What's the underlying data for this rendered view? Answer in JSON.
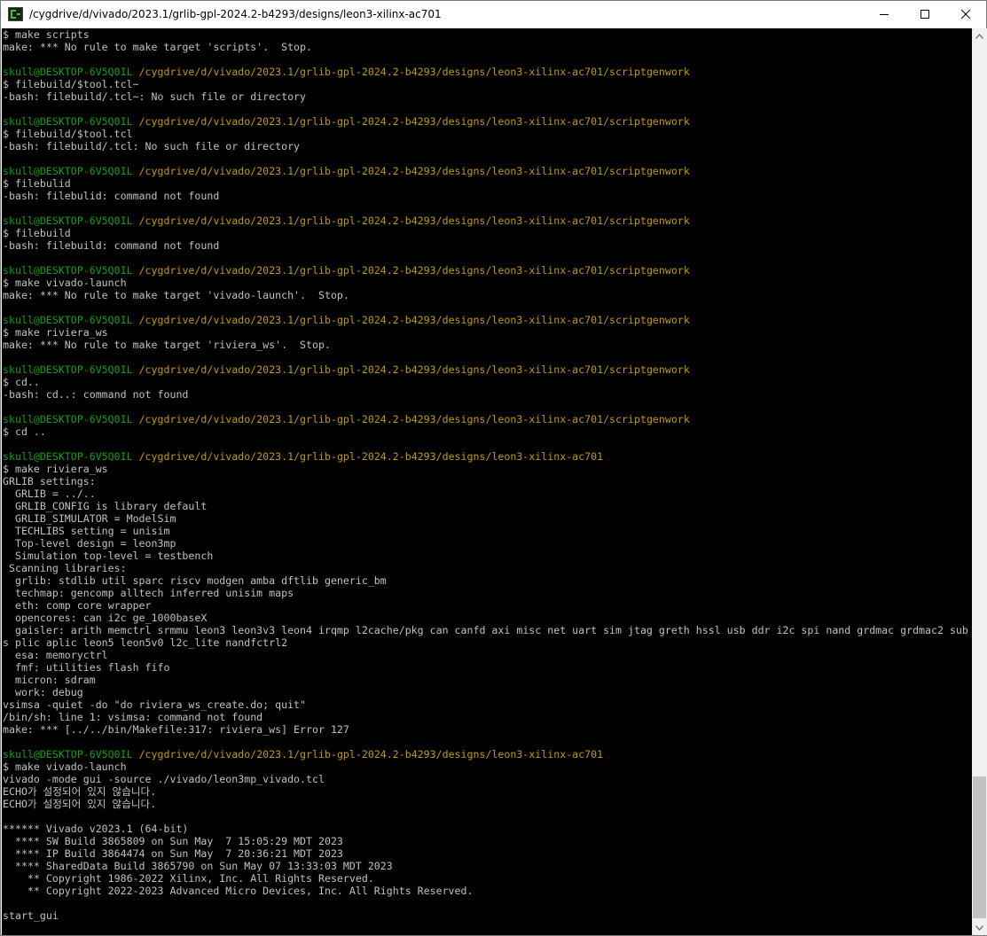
{
  "window": {
    "title": "/cygdrive/d/vivado/2023.1/grlib-gpl-2024.2-b4293/designs/leon3-xilinx-ac701",
    "buttons": {
      "minimize": "minimize",
      "maximize": "maximize",
      "close": "close"
    },
    "app_icon": "mintty-icon"
  },
  "colors": {
    "background": "#000000",
    "text": "#c0c0c0",
    "user": "#13a10e",
    "path": "#c19c00"
  },
  "terminal": {
    "prompt_user": "skull@DESKTOP-6V5Q0IL",
    "lines": [
      {
        "type": "text",
        "text": "$ make scripts"
      },
      {
        "type": "text",
        "text": "make: *** No rule to make target 'scripts'.  Stop."
      },
      {
        "type": "blank",
        "text": ""
      },
      {
        "type": "prompt",
        "user": "skull@DESKTOP-6V5Q0IL",
        "path": "/cygdrive/d/vivado/2023.1/grlib-gpl-2024.2-b4293/designs/leon3-xilinx-ac701/scriptgenwork"
      },
      {
        "type": "text",
        "text": "$ filebuild/$tool.tcl~"
      },
      {
        "type": "text",
        "text": "-bash: filebuild/.tcl~: No such file or directory"
      },
      {
        "type": "blank",
        "text": ""
      },
      {
        "type": "prompt",
        "user": "skull@DESKTOP-6V5Q0IL",
        "path": "/cygdrive/d/vivado/2023.1/grlib-gpl-2024.2-b4293/designs/leon3-xilinx-ac701/scriptgenwork"
      },
      {
        "type": "text",
        "text": "$ filebuild/$tool.tcl"
      },
      {
        "type": "text",
        "text": "-bash: filebuild/.tcl: No such file or directory"
      },
      {
        "type": "blank",
        "text": ""
      },
      {
        "type": "prompt",
        "user": "skull@DESKTOP-6V5Q0IL",
        "path": "/cygdrive/d/vivado/2023.1/grlib-gpl-2024.2-b4293/designs/leon3-xilinx-ac701/scriptgenwork"
      },
      {
        "type": "text",
        "text": "$ filebulid"
      },
      {
        "type": "text",
        "text": "-bash: filebulid: command not found"
      },
      {
        "type": "blank",
        "text": ""
      },
      {
        "type": "prompt",
        "user": "skull@DESKTOP-6V5Q0IL",
        "path": "/cygdrive/d/vivado/2023.1/grlib-gpl-2024.2-b4293/designs/leon3-xilinx-ac701/scriptgenwork"
      },
      {
        "type": "text",
        "text": "$ filebuild"
      },
      {
        "type": "text",
        "text": "-bash: filebuild: command not found"
      },
      {
        "type": "blank",
        "text": ""
      },
      {
        "type": "prompt",
        "user": "skull@DESKTOP-6V5Q0IL",
        "path": "/cygdrive/d/vivado/2023.1/grlib-gpl-2024.2-b4293/designs/leon3-xilinx-ac701/scriptgenwork"
      },
      {
        "type": "text",
        "text": "$ make vivado-launch"
      },
      {
        "type": "text",
        "text": "make: *** No rule to make target 'vivado-launch'.  Stop."
      },
      {
        "type": "blank",
        "text": ""
      },
      {
        "type": "prompt",
        "user": "skull@DESKTOP-6V5Q0IL",
        "path": "/cygdrive/d/vivado/2023.1/grlib-gpl-2024.2-b4293/designs/leon3-xilinx-ac701/scriptgenwork"
      },
      {
        "type": "text",
        "text": "$ make riviera_ws"
      },
      {
        "type": "text",
        "text": "make: *** No rule to make target 'riviera_ws'.  Stop."
      },
      {
        "type": "blank",
        "text": ""
      },
      {
        "type": "prompt",
        "user": "skull@DESKTOP-6V5Q0IL",
        "path": "/cygdrive/d/vivado/2023.1/grlib-gpl-2024.2-b4293/designs/leon3-xilinx-ac701/scriptgenwork"
      },
      {
        "type": "text",
        "text": "$ cd.."
      },
      {
        "type": "text",
        "text": "-bash: cd..: command not found"
      },
      {
        "type": "blank",
        "text": ""
      },
      {
        "type": "prompt",
        "user": "skull@DESKTOP-6V5Q0IL",
        "path": "/cygdrive/d/vivado/2023.1/grlib-gpl-2024.2-b4293/designs/leon3-xilinx-ac701/scriptgenwork"
      },
      {
        "type": "text",
        "text": "$ cd .."
      },
      {
        "type": "blank",
        "text": ""
      },
      {
        "type": "prompt",
        "user": "skull@DESKTOP-6V5Q0IL",
        "path": "/cygdrive/d/vivado/2023.1/grlib-gpl-2024.2-b4293/designs/leon3-xilinx-ac701"
      },
      {
        "type": "text",
        "text": "$ make riviera_ws"
      },
      {
        "type": "text",
        "text": "GRLIB settings:"
      },
      {
        "type": "text",
        "text": "  GRLIB = ../.."
      },
      {
        "type": "text",
        "text": "  GRLIB_CONFIG is library default"
      },
      {
        "type": "text",
        "text": "  GRLIB_SIMULATOR = ModelSim"
      },
      {
        "type": "text",
        "text": "  TECHLIBS setting = unisim"
      },
      {
        "type": "text",
        "text": "  Top-level design = leon3mp"
      },
      {
        "type": "text",
        "text": "  Simulation top-level = testbench"
      },
      {
        "type": "text",
        "text": " Scanning libraries:"
      },
      {
        "type": "text",
        "text": "  grlib: stdlib util sparc riscv modgen amba dftlib generic_bm"
      },
      {
        "type": "text",
        "text": "  techmap: gencomp alltech inferred unisim maps"
      },
      {
        "type": "text",
        "text": "  eth: comp core wrapper"
      },
      {
        "type": "text",
        "text": "  opencores: can i2c ge_1000baseX"
      },
      {
        "type": "text",
        "text": "  gaisler: arith memctrl srmmu leon3 leon3v3 leon4 irqmp l2cache/pkg can canfd axi misc net uart sim jtag greth hssl usb ddr i2c spi nand grdmac grdmac2 sub"
      },
      {
        "type": "text",
        "text": "s plic aplic leon5 leon5v0 l2c_lite nandfctrl2"
      },
      {
        "type": "text",
        "text": "  esa: memoryctrl"
      },
      {
        "type": "text",
        "text": "  fmf: utilities flash fifo"
      },
      {
        "type": "text",
        "text": "  micron: sdram"
      },
      {
        "type": "text",
        "text": "  work: debug"
      },
      {
        "type": "text",
        "text": "vsimsa -quiet -do \"do riviera_ws_create.do; quit\""
      },
      {
        "type": "text",
        "text": "/bin/sh: line 1: vsimsa: command not found"
      },
      {
        "type": "text",
        "text": "make: *** [../../bin/Makefile:317: riviera_ws] Error 127"
      },
      {
        "type": "blank",
        "text": ""
      },
      {
        "type": "prompt",
        "user": "skull@DESKTOP-6V5Q0IL",
        "path": "/cygdrive/d/vivado/2023.1/grlib-gpl-2024.2-b4293/designs/leon3-xilinx-ac701"
      },
      {
        "type": "text",
        "text": "$ make vivado-launch"
      },
      {
        "type": "text",
        "text": "vivado -mode gui -source ./vivado/leon3mp_vivado.tcl"
      },
      {
        "type": "text",
        "text": "ECHO가 설정되어 있지 않습니다."
      },
      {
        "type": "text",
        "text": "ECHO가 설정되어 있지 않습니다."
      },
      {
        "type": "blank",
        "text": ""
      },
      {
        "type": "text",
        "text": "****** Vivado v2023.1 (64-bit)"
      },
      {
        "type": "text",
        "text": "  **** SW Build 3865809 on Sun May  7 15:05:29 MDT 2023"
      },
      {
        "type": "text",
        "text": "  **** IP Build 3864474 on Sun May  7 20:36:21 MDT 2023"
      },
      {
        "type": "text",
        "text": "  **** SharedData Build 3865790 on Sun May 07 13:33:03 MDT 2023"
      },
      {
        "type": "text",
        "text": "    ** Copyright 1986-2022 Xilinx, Inc. All Rights Reserved."
      },
      {
        "type": "text",
        "text": "    ** Copyright 2022-2023 Advanced Micro Devices, Inc. All Rights Reserved."
      },
      {
        "type": "blank",
        "text": ""
      },
      {
        "type": "text",
        "text": "start_gui"
      }
    ]
  }
}
